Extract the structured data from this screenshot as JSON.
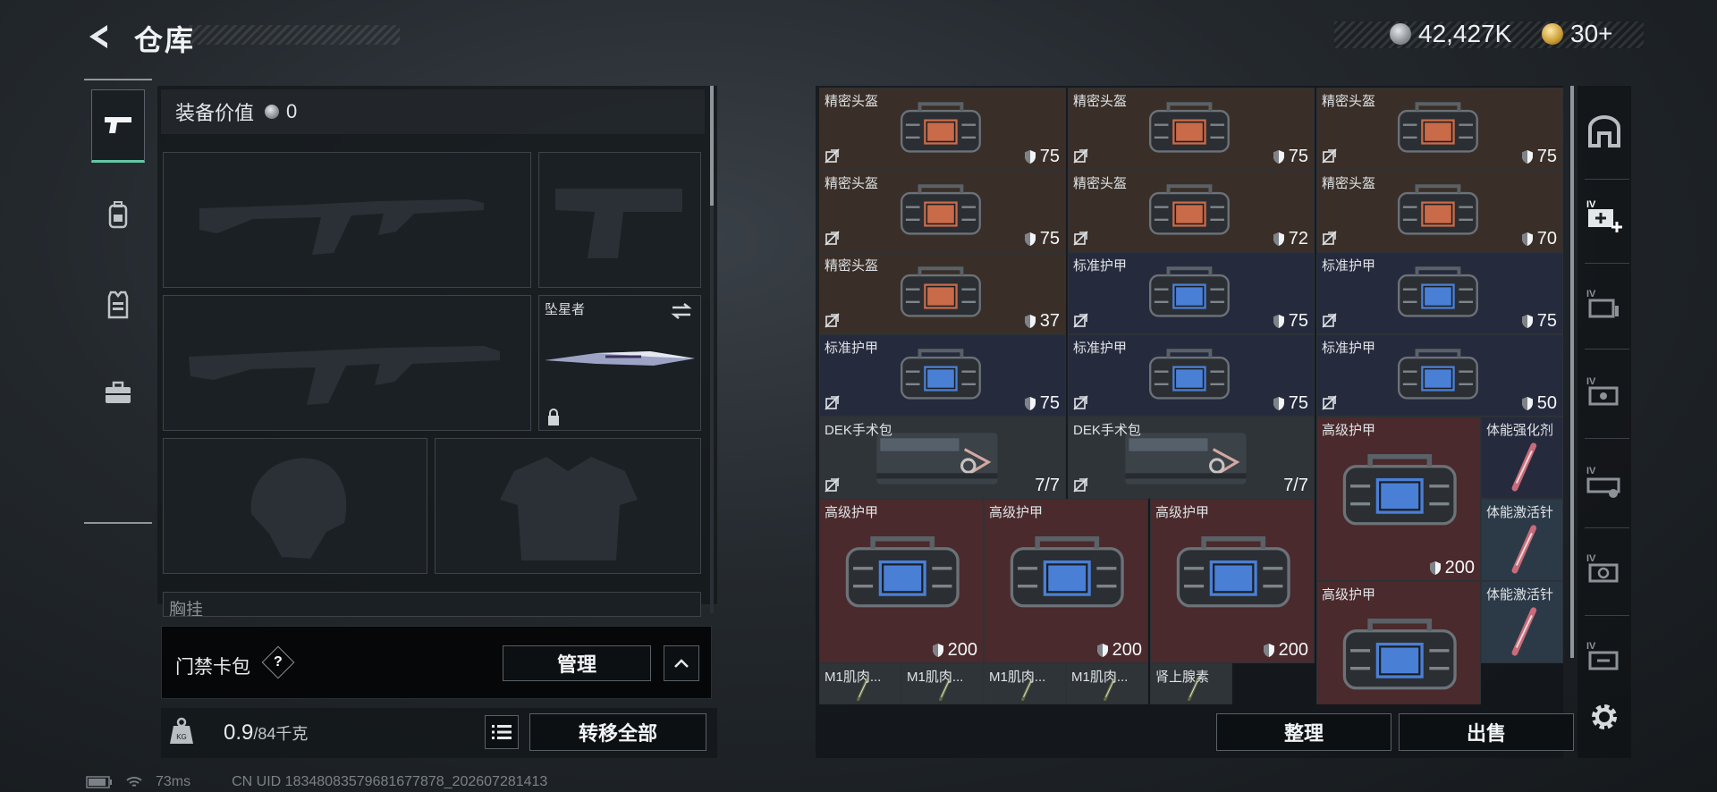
{
  "header": {
    "title": "仓库",
    "silver_amount": "42,427K",
    "gold_amount": "30+"
  },
  "left_rail": {
    "tabs": [
      "weapons",
      "backpack",
      "armor",
      "case"
    ]
  },
  "loadout": {
    "equip_value_label": "装备价值",
    "equip_value": "0",
    "melee_name": "坠星者",
    "chest_label": "胸挂"
  },
  "keycard": {
    "label": "门禁卡包",
    "help": "?",
    "manage_label": "管理"
  },
  "weight": {
    "current": "0.9",
    "capacity": "/84千克",
    "transfer_all_label": "转移全部"
  },
  "grid": {
    "items": [
      {
        "name": "精密头盔",
        "value": "75",
        "type": "helmet"
      },
      {
        "name": "精密头盔",
        "value": "75",
        "type": "helmet"
      },
      {
        "name": "精密头盔",
        "value": "75",
        "type": "helmet"
      },
      {
        "name": "精密头盔",
        "value": "75",
        "type": "helmet"
      },
      {
        "name": "精密头盔",
        "value": "72",
        "type": "helmet"
      },
      {
        "name": "精密头盔",
        "value": "70",
        "type": "helmet"
      },
      {
        "name": "精密头盔",
        "value": "37",
        "type": "helmet"
      },
      {
        "name": "标准护甲",
        "value": "75",
        "type": "armor"
      },
      {
        "name": "标准护甲",
        "value": "75",
        "type": "armor"
      },
      {
        "name": "标准护甲",
        "value": "75",
        "type": "armor"
      },
      {
        "name": "标准护甲",
        "value": "75",
        "type": "armor"
      },
      {
        "name": "标准护甲",
        "value": "50",
        "type": "armor"
      },
      {
        "name": "DEK手术包",
        "value": "7/7",
        "type": "medkit"
      },
      {
        "name": "DEK手术包",
        "value": "7/7",
        "type": "medkit"
      },
      {
        "name": "高级护甲",
        "value": "200",
        "type": "big-armor"
      },
      {
        "name": "体能强化剂",
        "value": "",
        "type": "injector"
      },
      {
        "name": "高级护甲",
        "value": "200",
        "type": "big-armor"
      },
      {
        "name": "高级护甲",
        "value": "200",
        "type": "big-armor"
      },
      {
        "name": "高级护甲",
        "value": "200",
        "type": "big-armor"
      },
      {
        "name": "体能激活针",
        "value": "",
        "type": "injector"
      },
      {
        "name": "高级护甲",
        "value": "",
        "type": "big-armor"
      },
      {
        "name": "体能激活针",
        "value": "",
        "type": "injector"
      },
      {
        "name": "M1肌肉...",
        "value": "",
        "type": "syringe"
      },
      {
        "name": "M1肌肉...",
        "value": "",
        "type": "syringe"
      },
      {
        "name": "M1肌肉...",
        "value": "",
        "type": "syringe"
      },
      {
        "name": "M1肌肉...",
        "value": "",
        "type": "syringe"
      },
      {
        "name": "肾上腺素",
        "value": "",
        "type": "syringe"
      }
    ],
    "sort_label": "整理",
    "sell_label": "出售"
  },
  "right_rail": {
    "icons": [
      "safebox-icon",
      "medkit-tier4-icon",
      "case-tier4-icon",
      "box-tier4-icon",
      "ammo-tier4-icon",
      "tool-tier4-icon",
      "item-tier4-icon"
    ],
    "tier_label": "IV"
  },
  "status": {
    "ping": "73ms",
    "uid": "CN UID 18348083579681677878_202607281413"
  },
  "colors": {
    "accent": "#63c7a4",
    "brown": "#3a2f28",
    "navy": "#262a3d",
    "red": "#4a2a2c"
  }
}
